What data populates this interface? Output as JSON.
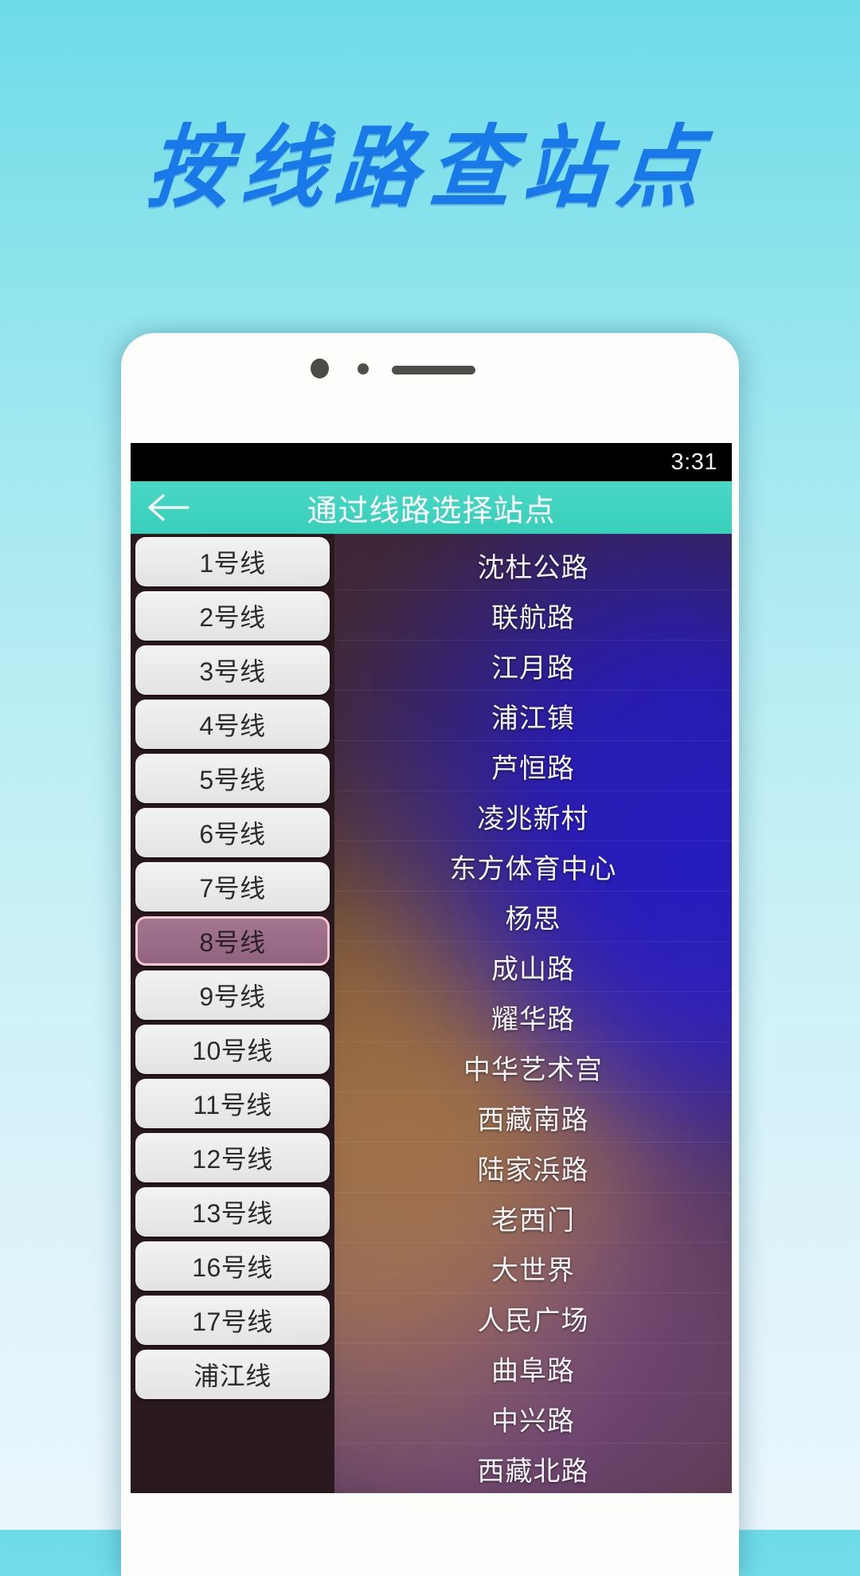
{
  "promo": {
    "title": "按线路查站点"
  },
  "colors": {
    "background_top": "#6ddbe8",
    "background_bottom": "#eaf6fc",
    "promo_title": "#1a79e8",
    "header_teal": "#3fd3be",
    "selected_line_fill": "#9a6c87",
    "selected_line_border": "#f6c6d3",
    "line_button_fill": "#eaeaea",
    "status_bar": "#000000"
  },
  "phone": {
    "bezel": {
      "camera_icon": "camera-dot-icon",
      "sensor_icon": "sensor-dot-icon",
      "speaker_icon": "speaker-bar-icon"
    }
  },
  "status_bar": {
    "time": "3:31"
  },
  "app_header": {
    "back_icon": "back-arrow-icon",
    "title": "通过线路选择站点"
  },
  "line_list": {
    "selected_index": 7,
    "items": [
      {
        "label": "1号线"
      },
      {
        "label": "2号线"
      },
      {
        "label": "3号线"
      },
      {
        "label": "4号线"
      },
      {
        "label": "5号线"
      },
      {
        "label": "6号线"
      },
      {
        "label": "7号线"
      },
      {
        "label": "8号线"
      },
      {
        "label": "9号线"
      },
      {
        "label": "10号线"
      },
      {
        "label": "11号线"
      },
      {
        "label": "12号线"
      },
      {
        "label": "13号线"
      },
      {
        "label": "16号线"
      },
      {
        "label": "17号线"
      },
      {
        "label": "浦江线"
      }
    ]
  },
  "station_list": {
    "items": [
      {
        "name": "沈杜公路"
      },
      {
        "name": "联航路"
      },
      {
        "name": "江月路"
      },
      {
        "name": "浦江镇"
      },
      {
        "name": "芦恒路"
      },
      {
        "name": "凌兆新村"
      },
      {
        "name": "东方体育中心"
      },
      {
        "name": "杨思"
      },
      {
        "name": "成山路"
      },
      {
        "name": "耀华路"
      },
      {
        "name": "中华艺术宫"
      },
      {
        "name": "西藏南路"
      },
      {
        "name": "陆家浜路"
      },
      {
        "name": "老西门"
      },
      {
        "name": "大世界"
      },
      {
        "name": "人民广场"
      },
      {
        "name": "曲阜路"
      },
      {
        "name": "中兴路"
      },
      {
        "name": "西藏北路"
      }
    ]
  }
}
